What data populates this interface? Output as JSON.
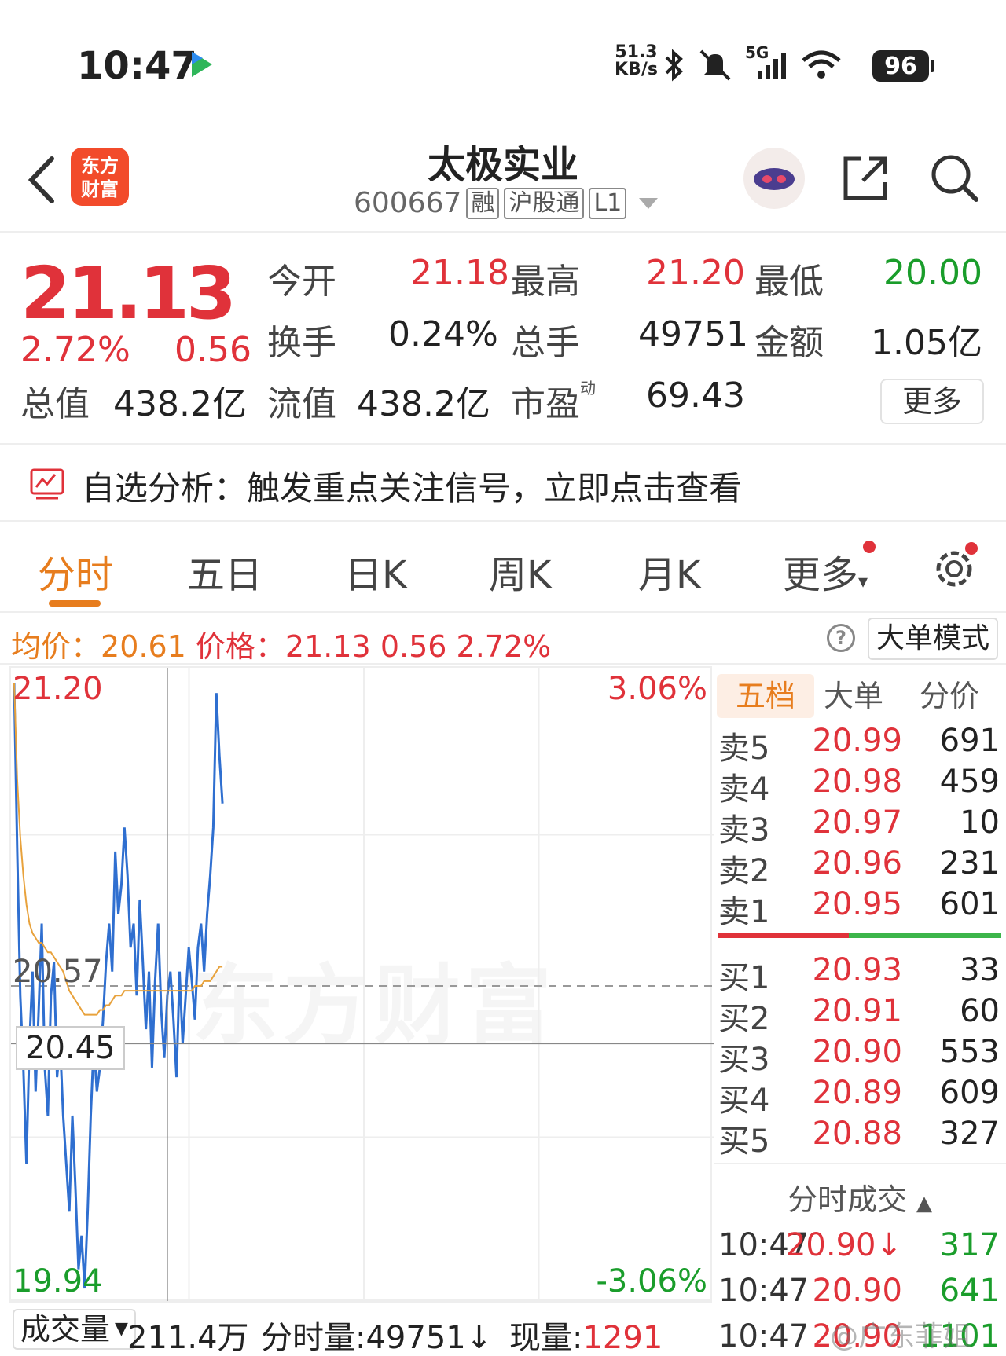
{
  "status_bar": {
    "time": "10:47",
    "net_speed_value": "51.3",
    "net_speed_unit": "KB/s",
    "signal_label": "5G",
    "battery": "96",
    "icons": [
      "bluetooth-icon",
      "mute-icon",
      "signal-icon",
      "wifi-icon",
      "battery-icon"
    ]
  },
  "header": {
    "logo_line1": "东方",
    "logo_line2": "财富",
    "stock_name": "太极实业",
    "stock_code": "600667",
    "tags": [
      "融",
      "沪股通",
      "L1"
    ]
  },
  "quote": {
    "price": "21.13",
    "change_pct": "2.72%",
    "change_amt": "0.56",
    "fields": {
      "open_label": "今开",
      "open": "21.18",
      "high_label": "最高",
      "high": "21.20",
      "low_label": "最低",
      "low": "20.00",
      "turnover_label": "换手",
      "turnover": "0.24%",
      "volume_label": "总手",
      "volume": "49751",
      "amount_label": "金额",
      "amount": "1.05亿",
      "mcap_label": "总值",
      "mcap": "438.2亿",
      "float_label": "流值",
      "float": "438.2亿",
      "pe_label": "市盈",
      "pe_sup": "动",
      "pe": "69.43"
    },
    "more_label": "更多"
  },
  "banner": {
    "text": "自选分析：触发重点关注信号，立即点击查看"
  },
  "tabs": {
    "items": [
      "分时",
      "五日",
      "日K",
      "周K",
      "月K",
      "更多"
    ],
    "active": "分时"
  },
  "infoline": {
    "avg_label": "均价：",
    "avg_value": "20.61",
    "price_label": "价格：",
    "price_value": "21.13",
    "chg_value": "0.56",
    "pct_value": "2.72%",
    "help": "?",
    "mode_label": "大单模式"
  },
  "chart": {
    "max_label": "21.20",
    "max_pct_label": "3.06%",
    "mid_label": "20.57",
    "cursor_label": "20.45",
    "min_label": "19.94",
    "min_pct_label": "-3.06%",
    "watermark": "东方财富",
    "colors": {
      "price": "#2f6fd0",
      "avg": "#e8a23c",
      "up": "#e0323a",
      "down": "#1a9d2b"
    }
  },
  "chart_data": {
    "type": "line",
    "ylim": [
      19.94,
      21.2
    ],
    "prev_close": 20.57,
    "ylabel_right_range": [
      "3.06%",
      "-3.06%"
    ],
    "series": [
      {
        "values": [
          21.2,
          20.85,
          20.55,
          20.4,
          20.2,
          20.45,
          20.6,
          20.35,
          20.52,
          20.7,
          20.4,
          20.3,
          20.55,
          20.62,
          20.38,
          20.45,
          20.3,
          20.2,
          20.1,
          20.3,
          20.15,
          19.98,
          20.05,
          19.94,
          20.1,
          20.3,
          20.45,
          20.35,
          20.4,
          20.5,
          20.62,
          20.7,
          20.6,
          20.85,
          20.72,
          20.78,
          20.9,
          20.8,
          20.65,
          20.7,
          20.55,
          20.75,
          20.62,
          20.48,
          20.6,
          20.4,
          20.58,
          20.7,
          20.52,
          20.42,
          20.55,
          20.6,
          20.5,
          20.38,
          20.6,
          20.45,
          20.55,
          20.65,
          20.58,
          20.5,
          20.65,
          20.7,
          20.6,
          20.72,
          20.8,
          20.9,
          21.18,
          21.05,
          20.95
        ]
      },
      {
        "values": [
          21.2,
          21.0,
          20.88,
          20.8,
          20.74,
          20.7,
          20.68,
          20.67,
          20.66,
          20.66,
          20.65,
          20.64,
          20.64,
          20.63,
          20.62,
          20.61,
          20.6,
          20.58,
          20.56,
          20.55,
          20.54,
          20.53,
          20.52,
          20.51,
          20.51,
          20.51,
          20.51,
          20.51,
          20.52,
          20.52,
          20.53,
          20.53,
          20.54,
          20.55,
          20.55,
          20.55,
          20.56,
          20.56,
          20.56,
          20.56,
          20.56,
          20.56,
          20.56,
          20.56,
          20.56,
          20.56,
          20.56,
          20.56,
          20.56,
          20.56,
          20.56,
          20.56,
          20.56,
          20.56,
          20.56,
          20.56,
          20.56,
          20.56,
          20.56,
          20.57,
          20.57,
          20.57,
          20.58,
          20.58,
          20.58,
          20.59,
          20.6,
          20.61,
          20.61
        ]
      }
    ]
  },
  "book": {
    "tabs": [
      "五档",
      "大单",
      "分价"
    ],
    "asks": [
      {
        "label": "卖5",
        "price": "20.99",
        "vol": "691"
      },
      {
        "label": "卖4",
        "price": "20.98",
        "vol": "459"
      },
      {
        "label": "卖3",
        "price": "20.97",
        "vol": "10"
      },
      {
        "label": "卖2",
        "price": "20.96",
        "vol": "231"
      },
      {
        "label": "卖1",
        "price": "20.95",
        "vol": "601"
      }
    ],
    "bids": [
      {
        "label": "买1",
        "price": "20.93",
        "vol": "33"
      },
      {
        "label": "买2",
        "price": "20.91",
        "vol": "60"
      },
      {
        "label": "买3",
        "price": "20.90",
        "vol": "553"
      },
      {
        "label": "买4",
        "price": "20.89",
        "vol": "609"
      },
      {
        "label": "买5",
        "price": "20.88",
        "vol": "327"
      }
    ],
    "trades_title": "分时成交",
    "trades": [
      {
        "time": "10:47",
        "price": "20.90↓",
        "vol": "317"
      },
      {
        "time": "10:47",
        "price": "20.90",
        "vol": "641"
      },
      {
        "time": "10:47",
        "price": "20.90",
        "vol": "1101"
      }
    ]
  },
  "volume_bar": {
    "selector": "成交量",
    "total": "211.4万",
    "period_label": "分时量:",
    "period_value": "49751↓",
    "now_label": "现量:",
    "now_value": "1291"
  },
  "watermark_weibo": "@广东菲姐"
}
